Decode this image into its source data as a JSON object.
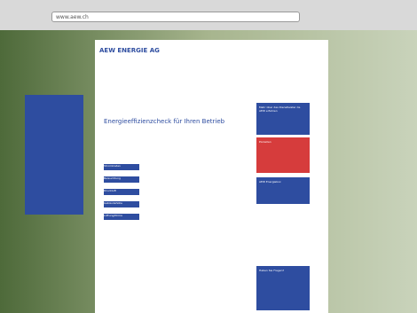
{
  "browser": {
    "url": "www.aew.ch"
  },
  "header": {
    "logo": "AEW ENERGIE AG"
  },
  "main": {
    "title": "Energieeffizienzcheck für Ihren Betrieb",
    "buttons": [
      "Stromkosten",
      "Beleuchtung",
      "Druckluft",
      "Gebäudehülle",
      "Lüftung/Klima"
    ]
  },
  "right": {
    "box1": "Mehr über das Dienstleister de AEW erfahren",
    "box2": "Porzellan",
    "box3": "AEW Energiebox",
    "box4": "Haben Sie Fragen?"
  }
}
